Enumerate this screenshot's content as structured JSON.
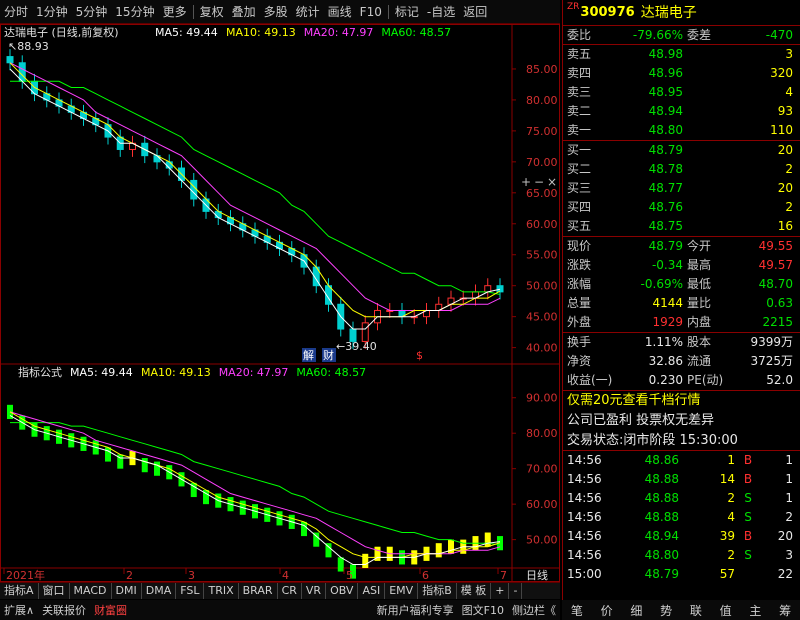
{
  "topbar": {
    "items": [
      "分时",
      "1分钟",
      "5分钟",
      "15分钟",
      "更多",
      "复权",
      "叠加",
      "多股",
      "统计",
      "画线",
      "F10",
      "标记",
      "-自选",
      "返回"
    ]
  },
  "main_chart": {
    "stock_label": "达瑞电子 (日线,前复权)",
    "legend": [
      {
        "label": "MA5:",
        "value": "49.44",
        "color": "#ffffff"
      },
      {
        "label": "MA10:",
        "value": "49.13",
        "color": "#ffff00"
      },
      {
        "label": "MA20:",
        "value": "47.97",
        "color": "#ff40ff"
      },
      {
        "label": "MA60:",
        "value": "48.57",
        "color": "#00ff00"
      }
    ],
    "y_ticks": [
      "85.00",
      "80.00",
      "75.00",
      "70.00",
      "65.00",
      "60.00",
      "55.00",
      "50.00",
      "45.00",
      "40.00"
    ],
    "high_label": "88.93",
    "low_label": "39.40",
    "markers": [
      "解",
      "财"
    ],
    "marker_s": "$"
  },
  "sub_chart": {
    "label": "指标公式",
    "legend": [
      {
        "label": "MA5:",
        "value": "49.44",
        "color": "#ffffff"
      },
      {
        "label": "MA10:",
        "value": "49.13",
        "color": "#ffff00"
      },
      {
        "label": "MA20:",
        "value": "47.97",
        "color": "#ff40ff"
      },
      {
        "label": "MA60:",
        "value": "48.57",
        "color": "#00ff00"
      }
    ],
    "y_ticks": [
      "90.00",
      "80.00",
      "70.00",
      "60.00",
      "50.00"
    ]
  },
  "x_axis": {
    "labels": [
      "2021年",
      "2",
      "3",
      "4",
      "5",
      "6",
      "7"
    ],
    "period": "日线"
  },
  "chart_data": {
    "type": "line",
    "x_months": [
      "2021-01",
      "2021-02",
      "2021-03",
      "2021-04",
      "2021-05",
      "2021-06",
      "2021-07"
    ],
    "close": [
      86,
      83,
      81,
      80,
      79,
      78,
      77,
      76,
      74,
      72,
      73,
      71,
      70,
      69,
      67,
      64,
      62,
      61,
      60,
      59,
      58,
      57,
      56,
      55,
      53,
      50,
      47,
      43,
      41,
      44,
      46,
      46,
      45,
      45,
      46,
      47,
      48,
      48,
      49,
      50,
      49
    ],
    "ma5": [
      85,
      83,
      81,
      80,
      79,
      78,
      77,
      76,
      75,
      73,
      73,
      72,
      71,
      69,
      67,
      65,
      63,
      61,
      60,
      59,
      58,
      57,
      56,
      55,
      54,
      51,
      48,
      45,
      43,
      43,
      45,
      45,
      45,
      45,
      46,
      46,
      47,
      48,
      48,
      49,
      49.44
    ],
    "ma10": [
      86,
      84,
      82,
      81,
      80,
      79,
      78,
      77,
      76,
      74,
      73,
      72,
      71,
      70,
      68,
      66,
      64,
      62,
      61,
      60,
      59,
      58,
      57,
      56,
      55,
      53,
      50,
      48,
      46,
      45,
      45,
      45,
      45,
      46,
      46,
      46,
      47,
      47,
      48,
      48,
      49.13
    ],
    "ma20": [
      86,
      85,
      84,
      83,
      82,
      81,
      80,
      78,
      77,
      76,
      75,
      74,
      73,
      72,
      71,
      69,
      67,
      65,
      63,
      62,
      61,
      60,
      59,
      58,
      57,
      56,
      54,
      52,
      50,
      48,
      47,
      46,
      46,
      46,
      46,
      46,
      46,
      47,
      47,
      47,
      47.97
    ],
    "ma60": [
      83,
      83,
      83,
      83,
      83,
      82,
      82,
      81,
      80,
      79,
      78,
      77,
      76,
      75,
      74,
      72,
      71,
      70,
      69,
      68,
      67,
      66,
      65,
      63,
      62,
      60,
      58,
      57,
      56,
      55,
      54,
      53,
      52,
      52,
      51,
      50,
      50,
      49,
      49,
      49,
      48.57
    ],
    "ylim": [
      38,
      90
    ]
  },
  "bottom_tabs": [
    "指标A",
    "窗口",
    "MACD",
    "DMI",
    "DMA",
    "FSL",
    "TRIX",
    "BRAR",
    "CR",
    "VR",
    "OBV",
    "ASI",
    "EMV",
    "指标B",
    "模 板",
    "+",
    "-"
  ],
  "status_tabs": [
    "扩展∧",
    "关联报价",
    "财富圈"
  ],
  "status_right": [
    "新用户福利专享",
    "图文F10",
    "侧边栏《"
  ],
  "quote": {
    "code": "300976",
    "name": "达瑞电子",
    "prefix": "ZR",
    "weibi_label": "委比",
    "weibi": "-79.66%",
    "weicha_label": "委差",
    "weicha": "-470",
    "sells": [
      {
        "label": "卖五",
        "price": "48.98",
        "vol": "3"
      },
      {
        "label": "卖四",
        "price": "48.96",
        "vol": "320"
      },
      {
        "label": "卖三",
        "price": "48.95",
        "vol": "4"
      },
      {
        "label": "卖二",
        "price": "48.94",
        "vol": "93"
      },
      {
        "label": "卖一",
        "price": "48.80",
        "vol": "110"
      }
    ],
    "buys": [
      {
        "label": "买一",
        "price": "48.79",
        "vol": "20"
      },
      {
        "label": "买二",
        "price": "48.78",
        "vol": "2"
      },
      {
        "label": "买三",
        "price": "48.77",
        "vol": "20"
      },
      {
        "label": "买四",
        "price": "48.76",
        "vol": "2"
      },
      {
        "label": "买五",
        "price": "48.75",
        "vol": "16"
      }
    ],
    "stats1": [
      {
        "l1": "现价",
        "v1": "48.79",
        "c1": "green",
        "l2": "今开",
        "v2": "49.55",
        "c2": "red"
      },
      {
        "l1": "涨跌",
        "v1": "-0.34",
        "c1": "green",
        "l2": "最高",
        "v2": "49.57",
        "c2": "red"
      },
      {
        "l1": "涨幅",
        "v1": "-0.69%",
        "c1": "green",
        "l2": "最低",
        "v2": "48.70",
        "c2": "green"
      },
      {
        "l1": "总量",
        "v1": "4144",
        "c1": "yellow",
        "l2": "量比",
        "v2": "0.63",
        "c2": "green"
      },
      {
        "l1": "外盘",
        "v1": "1929",
        "c1": "red",
        "l2": "内盘",
        "v2": "2215",
        "c2": "green"
      }
    ],
    "stats2": [
      {
        "l1": "换手",
        "v1": "1.11%",
        "l2": "股本",
        "v2": "9399万"
      },
      {
        "l1": "净资",
        "v1": "32.86",
        "l2": "流通",
        "v2": "3725万"
      },
      {
        "l1": "收益(一)",
        "v1": "0.230",
        "l2": "PE(动)",
        "v2": "52.0"
      }
    ],
    "promo1": "仅需20元查看千档行情",
    "promo2": "公司已盈利 投票权无差异",
    "trade_status": "交易状态:闭市阶段 15:30:00",
    "ticks": [
      {
        "time": "14:56",
        "price": "48.86",
        "vol": "1",
        "dir": "B",
        "n": "1"
      },
      {
        "time": "14:56",
        "price": "48.88",
        "vol": "14",
        "dir": "B",
        "n": "1"
      },
      {
        "time": "14:56",
        "price": "48.88",
        "vol": "2",
        "dir": "S",
        "n": "1"
      },
      {
        "time": "14:56",
        "price": "48.88",
        "vol": "4",
        "dir": "S",
        "n": "2"
      },
      {
        "time": "14:56",
        "price": "48.94",
        "vol": "39",
        "dir": "B",
        "n": "20"
      },
      {
        "time": "14:56",
        "price": "48.80",
        "vol": "2",
        "dir": "S",
        "n": "3"
      },
      {
        "time": "15:00",
        "price": "48.79",
        "vol": "57",
        "dir": "",
        "n": "22"
      }
    ]
  },
  "nav": [
    "笔",
    "价",
    "细",
    "势",
    "联",
    "值",
    "主",
    "筹"
  ]
}
